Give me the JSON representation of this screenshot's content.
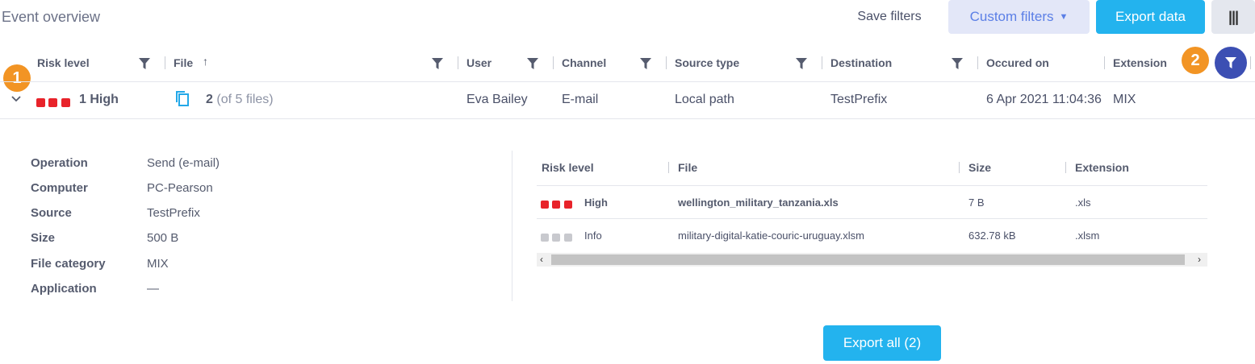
{
  "header": {
    "title": "Event overview",
    "save_filters": "Save filters",
    "custom_filters": "Custom filters",
    "export_data": "Export data"
  },
  "columns": [
    {
      "label": "Risk level"
    },
    {
      "label": "File"
    },
    {
      "label": "User"
    },
    {
      "label": "Channel"
    },
    {
      "label": "Source type"
    },
    {
      "label": "Destination"
    },
    {
      "label": "Occured on"
    },
    {
      "label": "Extension"
    }
  ],
  "badges": {
    "first": "1",
    "second": "2"
  },
  "row": {
    "risk": "1 High",
    "file_count": "2",
    "file_total": "(of 5 files)",
    "user": "Eva Bailey",
    "channel": "E-mail",
    "source_type": "Local path",
    "destination": "TestPrefix",
    "occured_on": "6 Apr 2021 11:04:36",
    "extension": "MIX"
  },
  "details": [
    {
      "label": "Operation",
      "value": "Send (e-mail)"
    },
    {
      "label": "Computer",
      "value": "PC-Pearson"
    },
    {
      "label": "Source",
      "value": "TestPrefix"
    },
    {
      "label": "Size",
      "value": "500 B"
    },
    {
      "label": "File category",
      "value": "MIX"
    },
    {
      "label": "Application",
      "value": "—"
    }
  ],
  "files_table": {
    "headers": [
      "Risk level",
      "File",
      "Size",
      "Extension"
    ],
    "rows": [
      {
        "risk": "High",
        "file": "wellington_military_tanzania.xls",
        "size": "7 B",
        "extension": ".xls"
      },
      {
        "risk": "Info",
        "file": "military-digital-katie-couric-uruguay.xlsm",
        "size": "632.78 kB",
        "extension": ".xlsm"
      }
    ]
  },
  "export_all": "Export all (2)",
  "colors": {
    "accent": "#23b3ee",
    "high_risk": "#e8232a",
    "info_risk": "#c8c9ce",
    "badge": "#f29424",
    "filter_button": "#3c4fb3"
  }
}
